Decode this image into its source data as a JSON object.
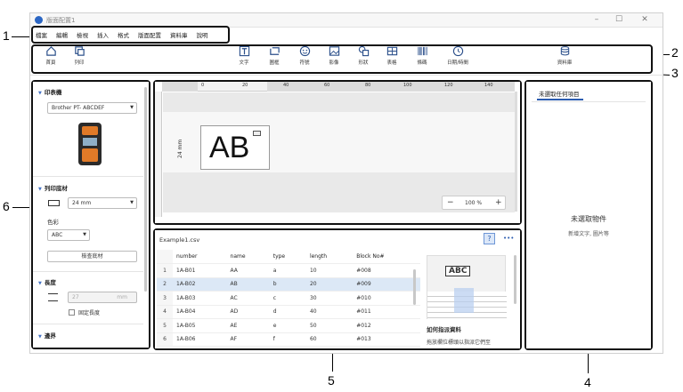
{
  "callouts": [
    "1",
    "2",
    "3",
    "4",
    "5",
    "6"
  ],
  "window": {
    "title": "版面配置1"
  },
  "menu": [
    "檔案",
    "編輯",
    "檢視",
    "插入",
    "格式",
    "版面配置",
    "資料庫",
    "說明"
  ],
  "toolbar": {
    "home": "首頁",
    "print": "列印",
    "text": "文字",
    "frame": "圖框",
    "symbol": "符號",
    "image": "影像",
    "shape": "形狀",
    "table": "表格",
    "barcode": "條碼",
    "datetime": "日期/時間",
    "database": "資料庫"
  },
  "left_panel": {
    "printer_section": "印表機",
    "printer_model": "Brother PT- ABCDEF",
    "media_section": "列印底材",
    "tape_width": "24 mm",
    "color_label": "色彩",
    "color_value": "ABC",
    "check_media": "檢查底材",
    "length_section": "長度",
    "length_value": "27",
    "length_unit": "mm",
    "fixed_length": "固定長度",
    "margin_section": "邊界"
  },
  "canvas": {
    "ruler_ticks": [
      "0",
      "20",
      "40",
      "60",
      "80",
      "100",
      "120",
      "140"
    ],
    "label_text": "AB",
    "label_size": "24 mm",
    "zoom": "100 %"
  },
  "database": {
    "file": "Example1.csv",
    "help": "?",
    "more": "•••",
    "columns": [
      "number",
      "name",
      "type",
      "length",
      "Block No#"
    ],
    "rows": [
      [
        "1",
        "1A-B01",
        "AA",
        "a",
        "10",
        "#008"
      ],
      [
        "2",
        "1A-B02",
        "AB",
        "b",
        "20",
        "#009"
      ],
      [
        "3",
        "1A-B03",
        "AC",
        "c",
        "30",
        "#010"
      ],
      [
        "4",
        "1A-B04",
        "AD",
        "d",
        "40",
        "#011"
      ],
      [
        "5",
        "1A-B05",
        "AE",
        "e",
        "50",
        "#012"
      ],
      [
        "6",
        "1A-B06",
        "AF",
        "f",
        "60",
        "#013"
      ]
    ],
    "hint_preview": "ABC",
    "hint_title": "如何指派資料",
    "hint_text": "拖放欄位標頭以指派它們至"
  },
  "right_panel": {
    "tab": "未選取任何項目",
    "empty_title": "未選取物件",
    "empty_sub": "新增文字, 圖片等"
  }
}
